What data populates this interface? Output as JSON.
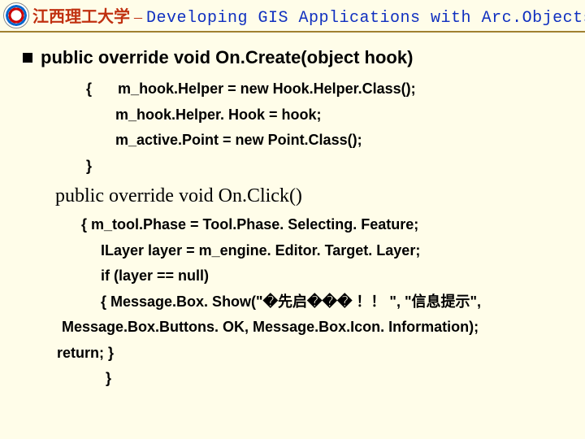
{
  "header": {
    "cn": "江西理工大学",
    "dash": " – ",
    "en": "Developing GIS Applications with Arc.Objects using C#. NET"
  },
  "method1": {
    "signature": "public override void On.Create(object hook)",
    "open": "{",
    "l1": "m_hook.Helper = new Hook.Helper.Class();",
    "l2": "m_hook.Helper. Hook = hook;",
    "l3": "m_active.Point = new Point.Class();",
    "close": "}"
  },
  "method2": {
    "signature": "public override void On.Click()",
    "l1": "{   m_tool.Phase = Tool.Phase. Selecting. Feature;",
    "l2": "ILayer layer = m_engine. Editor. Target. Layer;",
    "l3": "if (layer == null)",
    "l4": "{    Message.Box. Show(\"�先启��� ！！ \", \"信息提示\",",
    "l5": "Message.Box.Buttons. OK, Message.Box.Icon. Information);",
    "l6": "return;      }",
    "l7": "}"
  }
}
